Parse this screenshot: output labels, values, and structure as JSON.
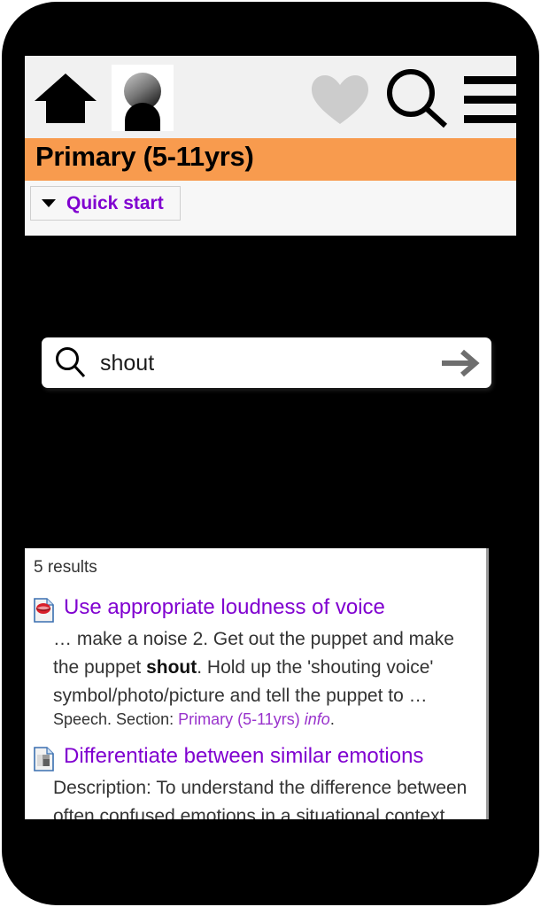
{
  "app": {
    "title": "Primary (5-11yrs)",
    "title_bar_color": "#f89b4e",
    "accent_purple": "#8000d0",
    "link_purple": "#9933cc"
  },
  "icon_bar": {
    "home": {
      "name": "home-icon",
      "label": "Home"
    },
    "account": {
      "name": "account-avatar-icon",
      "label": "Account"
    },
    "favorites": {
      "name": "heart-icon",
      "label": "Favourites",
      "color": "#cccccc"
    },
    "search": {
      "name": "search-icon",
      "label": "Search",
      "color": "#000000"
    },
    "menu": {
      "name": "hamburger-menu-icon",
      "label": "Menu",
      "color": "#000000"
    }
  },
  "quick_start": {
    "label": "Quick start",
    "caret": "chevron-down-icon"
  },
  "search": {
    "value": "shout",
    "placeholder": "Search",
    "magnifier_icon": "search-icon",
    "submit_icon": "arrow-right-icon",
    "submit_color": "#6e6e6e"
  },
  "results": {
    "count_label": "5 results",
    "items": [
      {
        "icon": "document-speech-icon",
        "title": "Use appropriate loudness of voice",
        "snippet_before": "… make a noise 2. Get out the puppet and make the puppet ",
        "snippet_highlight": "shout",
        "snippet_after": ". Hold up the 'shouting voice' symbol/photo/picture and tell the puppet to …",
        "meta_prefix": "Speech. Section: ",
        "meta_section": "Primary (5-11yrs)",
        "meta_info": "info",
        "meta_suffix": "."
      },
      {
        "icon": "document-image-icon",
        "title": "Differentiate between similar emotions",
        "snippet_before": "Description:  To understand the difference between often confused emotions in a situational context, e.g.",
        "snippet_highlight": "",
        "snippet_after": "",
        "meta_prefix": "",
        "meta_section": "",
        "meta_info": "",
        "meta_suffix": ""
      }
    ]
  }
}
